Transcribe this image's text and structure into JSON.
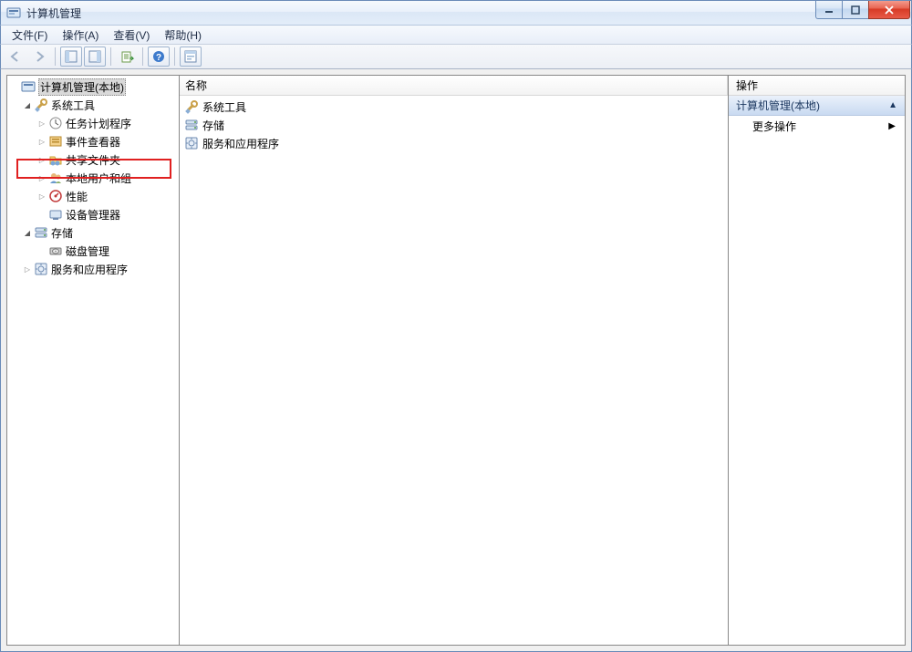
{
  "window": {
    "title": "计算机管理"
  },
  "menubar": {
    "file": "文件(F)",
    "action": "操作(A)",
    "view": "查看(V)",
    "help": "帮助(H)"
  },
  "toolbar": {
    "back": "back-icon",
    "forward": "forward-icon",
    "up": "up-icon",
    "show_hide": "show-hide-tree-icon",
    "export": "export-list-icon",
    "help": "help-icon",
    "properties": "properties-icon"
  },
  "tree": {
    "root": {
      "label": "计算机管理(本地)",
      "selected": true
    },
    "system_tools": {
      "label": "系统工具",
      "children": {
        "task_scheduler": "任务计划程序",
        "event_viewer": "事件查看器",
        "shared_folders": "共享文件夹",
        "local_users_groups": "本地用户和组",
        "performance": "性能",
        "device_manager": "设备管理器"
      }
    },
    "storage": {
      "label": "存储",
      "children": {
        "disk_management": "磁盘管理"
      }
    },
    "services_apps": {
      "label": "服务和应用程序"
    }
  },
  "list": {
    "column_header": "名称",
    "rows": {
      "system_tools": "系统工具",
      "storage": "存储",
      "services_apps": "服务和应用程序"
    }
  },
  "actions_panel": {
    "header": "操作",
    "section": "计算机管理(本地)",
    "more_actions": "更多操作"
  }
}
